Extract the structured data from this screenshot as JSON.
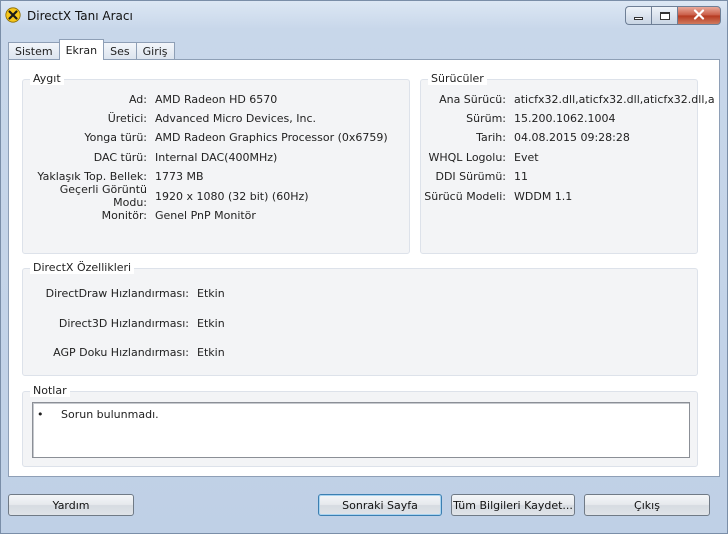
{
  "window": {
    "title": "DirectX Tanı Aracı"
  },
  "tabs": [
    {
      "label": "Sistem",
      "active": false
    },
    {
      "label": "Ekran",
      "active": true
    },
    {
      "label": "Ses",
      "active": false
    },
    {
      "label": "Giriş",
      "active": false
    }
  ],
  "device": {
    "title": "Aygıt",
    "rows": [
      {
        "label": "Ad:",
        "value": "AMD Radeon HD 6570"
      },
      {
        "label": "Üretici:",
        "value": "Advanced Micro Devices, Inc."
      },
      {
        "label": "Yonga türü:",
        "value": "AMD Radeon Graphics Processor (0x6759)"
      },
      {
        "label": "DAC türü:",
        "value": "Internal DAC(400MHz)"
      },
      {
        "label": "Yaklaşık Top. Bellek:",
        "value": "1773 MB"
      },
      {
        "label": "Geçerli Görüntü Modu:",
        "value": "1920 x 1080 (32 bit) (60Hz)"
      },
      {
        "label": "Monitör:",
        "value": "Genel PnP Monitör"
      }
    ]
  },
  "drivers": {
    "title": "Sürücüler",
    "rows": [
      {
        "label": "Ana Sürücü:",
        "value": "aticfx32.dll,aticfx32.dll,aticfx32.dll,a"
      },
      {
        "label": "Sürüm:",
        "value": "15.200.1062.1004"
      },
      {
        "label": "Tarih:",
        "value": "04.08.2015 09:28:28"
      },
      {
        "label": "WHQL Logolu:",
        "value": "Evet"
      },
      {
        "label": "DDI Sürümü:",
        "value": "11"
      },
      {
        "label": "Sürücü Modeli:",
        "value": "WDDM 1.1"
      }
    ]
  },
  "features": {
    "title": "DirectX Özellikleri",
    "rows": [
      {
        "label": "DirectDraw Hızlandırması:",
        "value": "Etkin"
      },
      {
        "label": "Direct3D Hızlandırması:",
        "value": "Etkin"
      },
      {
        "label": "AGP Doku Hızlandırması:",
        "value": "Etkin"
      }
    ]
  },
  "notes": {
    "title": "Notlar",
    "items": [
      {
        "bullet": "•",
        "text": "Sorun bulunmadı."
      }
    ]
  },
  "buttons": {
    "help": "Yardım",
    "next_page": "Sonraki Sayfa",
    "save_all": "Tüm Bilgileri Kaydet...",
    "exit": "Çıkış"
  },
  "colors": {
    "accent_close": "#c85a44",
    "default_button_border": "#3c7fb1"
  },
  "icons": {
    "app": "directx-x-icon",
    "minimize": "minimize-icon",
    "maximize": "maximize-icon",
    "close": "close-icon"
  }
}
